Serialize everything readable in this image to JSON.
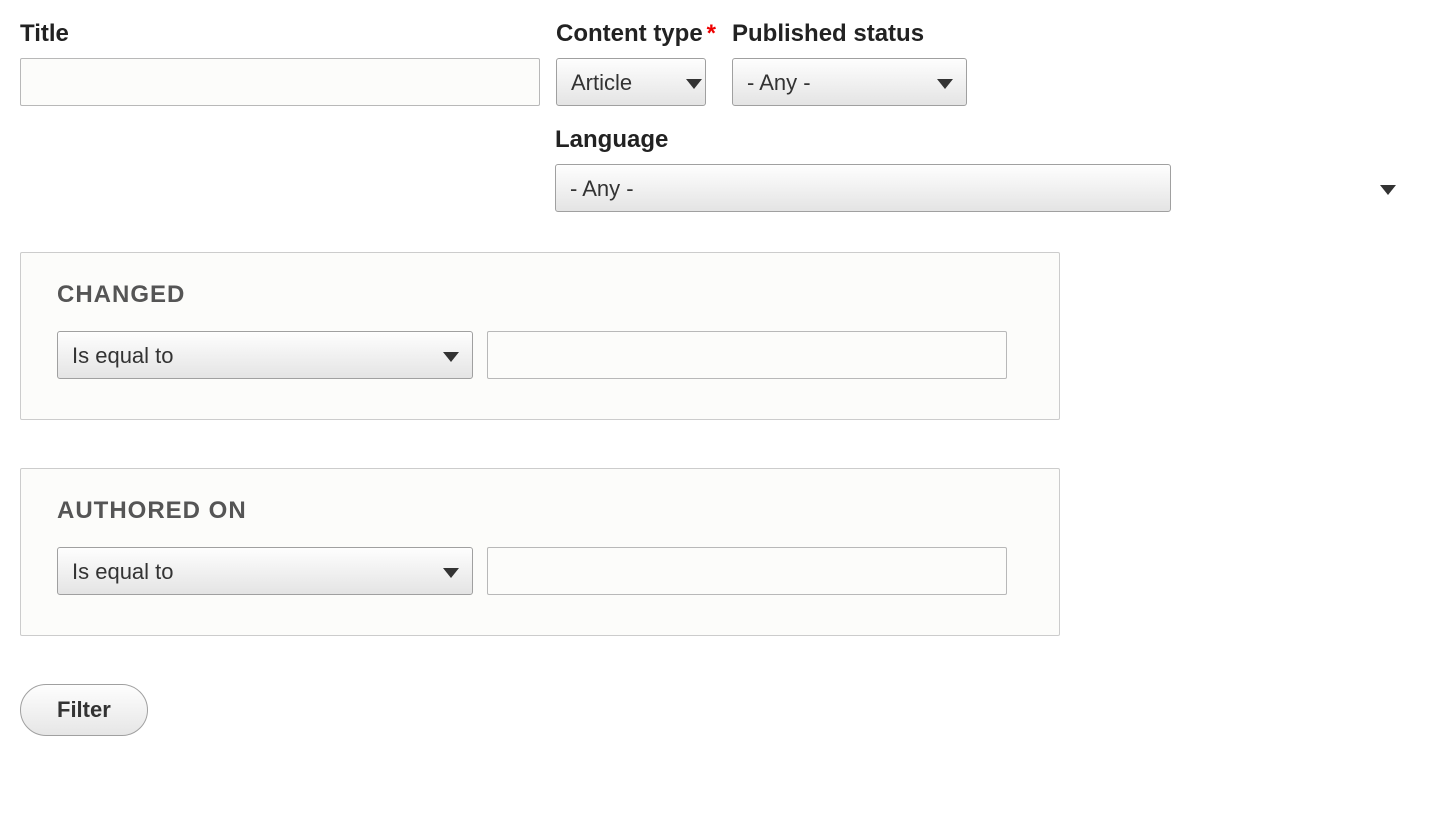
{
  "filters": {
    "title": {
      "label": "Title",
      "value": ""
    },
    "content_type": {
      "label": "Content type",
      "required": true,
      "selected": "Article"
    },
    "published_status": {
      "label": "Published status",
      "selected": "- Any -"
    },
    "language": {
      "label": "Language",
      "selected": "- Any -"
    }
  },
  "changed": {
    "legend": "Changed",
    "operator": "Is equal to",
    "value": ""
  },
  "authored_on": {
    "legend": "Authored on",
    "operator": "Is equal to",
    "value": ""
  },
  "actions": {
    "filter": "Filter"
  }
}
